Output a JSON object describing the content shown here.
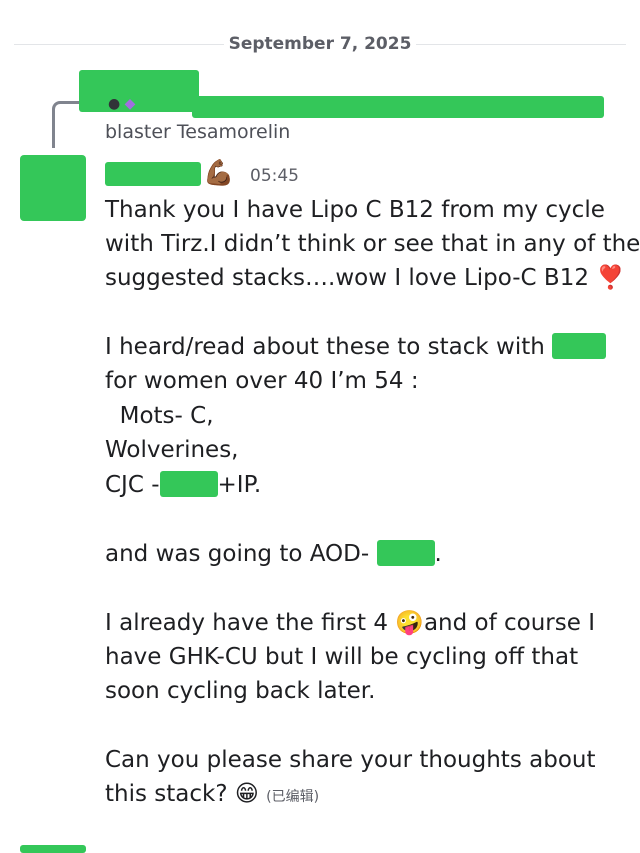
{
  "date_separator": "September 7, 2025",
  "reply": {
    "icons": [
      "avatar-icon",
      "diamond-badge-icon"
    ],
    "preview_text": "blaster Tesamorelin"
  },
  "message": {
    "author_emoji": "💪🏾",
    "timestamp": "05:45",
    "lines": {
      "l1": "Thank you I have Lipo C B12 from my cycle",
      "l2": "with Tirz.I didn’t think or see that in any of the",
      "l3": "suggested stacks….wow I love Lipo-C B12",
      "l4": "I heard/read  about these to  stack with",
      "l5": "for women over 40  I’m 54 :",
      "l6": "  Mots- C,",
      "l7": "Wolverines,",
      "l8a": "CJC -",
      "l8b": "+IP.",
      "l9a": "and was going to  AOD-",
      "l9b": ".",
      "l10a": "I already have the first 4",
      "l10b": "and of course I",
      "l11": "have GHK-CU but I will be cycling off that",
      "l12": "soon cycling back later.",
      "l13": "Can you please share your thoughts about",
      "l14": "this stack?"
    },
    "emojis": {
      "heart": "❣️",
      "zany": "🤪",
      "grin": "😁"
    },
    "edited_label": "(已编辑)"
  }
}
